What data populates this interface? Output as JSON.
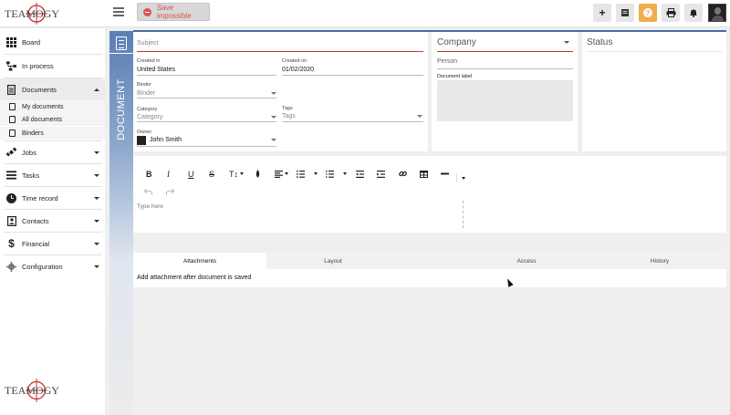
{
  "app": {
    "logo_text": "TEAMOGY"
  },
  "toolbar": {
    "save_label": "Save impossible",
    "add_icon": "plus-icon",
    "notes_icon": "notes-icon",
    "help_icon": "question-icon",
    "print_icon": "print-icon",
    "bell_icon": "bell-icon",
    "help_color": "#f0ad4e",
    "save_color": "#d9534f"
  },
  "sidebar": {
    "items": [
      {
        "label": "Board",
        "icon": "grid-icon"
      },
      {
        "label": "In process",
        "icon": "flow-icon"
      },
      {
        "label": "Documents",
        "icon": "document-icon"
      },
      {
        "label": "Jobs",
        "icon": "satellite-icon"
      },
      {
        "label": "Tasks",
        "icon": "tasks-icon"
      },
      {
        "label": "Time record",
        "icon": "clock-icon"
      },
      {
        "label": "Contacts",
        "icon": "contact-icon"
      },
      {
        "label": "Financial",
        "icon": "dollar-icon"
      },
      {
        "label": "Configuration",
        "icon": "gear-icon"
      }
    ],
    "documents_sub": [
      {
        "label": "My documents"
      },
      {
        "label": "All documents"
      },
      {
        "label": "Binders"
      }
    ]
  },
  "doc_tab": {
    "label": "DOCUMENT",
    "accent": "#4a6da3"
  },
  "form": {
    "subject_placeholder": "Subject",
    "created_in_label": "Created in",
    "created_in_value": "United States",
    "created_on_label": "Created on",
    "created_on_value": "01/02/2020",
    "binder_label": "Binder",
    "binder_value": "Binder",
    "category_label": "Category",
    "category_value": "Category",
    "tags_label": "Tags",
    "tags_value": "Tags",
    "owner_label": "Owner",
    "owner_value": "John Smith"
  },
  "company": {
    "label": "Company",
    "person": "Person",
    "document_label": "Document label"
  },
  "status": {
    "label": "Status"
  },
  "editor": {
    "placeholder": "Type here",
    "tools": [
      "B",
      "I",
      "U",
      "S",
      "T↕"
    ]
  },
  "tabs": [
    {
      "label": "Attachments",
      "active": true
    },
    {
      "label": "Layout",
      "active": false
    },
    {
      "label": "Access",
      "active": false
    },
    {
      "label": "History",
      "active": false
    }
  ],
  "attachments": {
    "message": "Add attachment after document is saved"
  }
}
